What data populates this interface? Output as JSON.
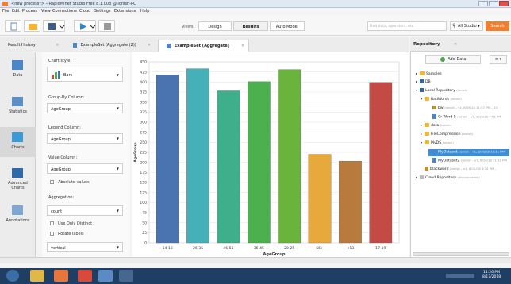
{
  "window": {
    "title": "<new process*> – RapidMiner Studio Free 8.1.003 @ lonish-PC"
  },
  "menu": [
    "File",
    "Edit",
    "Process",
    "View",
    "Connections",
    "Cloud",
    "Settings",
    "Extensions",
    "Help"
  ],
  "toolbar": {
    "views_label": "Views:",
    "view_tabs": [
      "Design",
      "Results",
      "Auto Model"
    ],
    "active_view": "Results",
    "search_placeholder": "Find data, operators, etc",
    "all_studio": "All Studio",
    "search_button": "Search"
  },
  "tabs": [
    {
      "label": "Result History"
    },
    {
      "label": "ExampleSet (Aggregate (2))"
    },
    {
      "label": "ExampleSet (Aggregate)"
    }
  ],
  "sidenav": [
    "Data",
    "Statistics",
    "Charts",
    "Advanced Charts",
    "Annotations"
  ],
  "sidenav_active": "Charts",
  "panel": {
    "chart_style_label": "Chart style:",
    "chart_style_value": "Bars",
    "group_by_label": "Group-By Column:",
    "group_by_value": "AgeGroup",
    "legend_label": "Legend Column:",
    "legend_value": "AgeGroup",
    "value_label": "Value Column:",
    "value_value": "AgeGroup",
    "absolute_values": "Absolute values",
    "aggregation_label": "Aggregation:",
    "aggregation_value": "count",
    "use_only_distinct": "Use Only Distinct",
    "rotate_labels": "Rotate labels",
    "orientation_value": "vertical"
  },
  "chart_data": {
    "type": "bar",
    "categories": [
      "14-18",
      "26-35",
      "46-55",
      "36-45",
      "20-25",
      "56+",
      "<13",
      "17-19"
    ],
    "values": [
      418,
      433,
      378,
      401,
      431,
      220,
      203,
      399
    ],
    "colors": [
      "#4a74b0",
      "#46b0b8",
      "#3fae8a",
      "#4db04f",
      "#6ab43e",
      "#e8a93c",
      "#b97b3d",
      "#c44b45"
    ],
    "xlabel": "AgeGroup",
    "ylabel": "AgeGroup",
    "ylim": [
      0,
      450
    ],
    "yticks": [
      0,
      25,
      50,
      75,
      100,
      125,
      150,
      175,
      200,
      225,
      250,
      275,
      300,
      325,
      350,
      375,
      400,
      425,
      450
    ],
    "grid": true
  },
  "repository": {
    "title": "Repository",
    "add_data": "Add Data",
    "items": [
      {
        "label": "Samples",
        "meta": ""
      },
      {
        "label": "DB",
        "meta": ""
      },
      {
        "label": "Local Repository",
        "meta": "(ionish)"
      },
      {
        "label": "BadWords",
        "meta": "(ionish)"
      },
      {
        "label": "bw",
        "meta": "(ionish – v1, 8/16/18 11:57 PM – 10"
      },
      {
        "label": "Cr Word 5",
        "meta": "(ionish – v1, 8/16/18 7:52 PM"
      },
      {
        "label": "data",
        "meta": "(ionish)"
      },
      {
        "label": "FileCompression",
        "meta": "(ionish)"
      },
      {
        "label": "MyDS",
        "meta": "(ionish)"
      },
      {
        "label": "MyDataset",
        "meta": "(ionish – v1, 8/16/18 11:11 PM"
      },
      {
        "label": "MyDataset2",
        "meta": "(ionish – v1, 8/16/18 11:11 PM"
      },
      {
        "label": "blackword",
        "meta": "(ionish – v1, 8/12/18 6:24 PM –"
      },
      {
        "label": "Cloud Repository",
        "meta": "(disconnected)"
      }
    ]
  },
  "clock": {
    "time": "11:26 PM",
    "date": "8/17/2018"
  }
}
